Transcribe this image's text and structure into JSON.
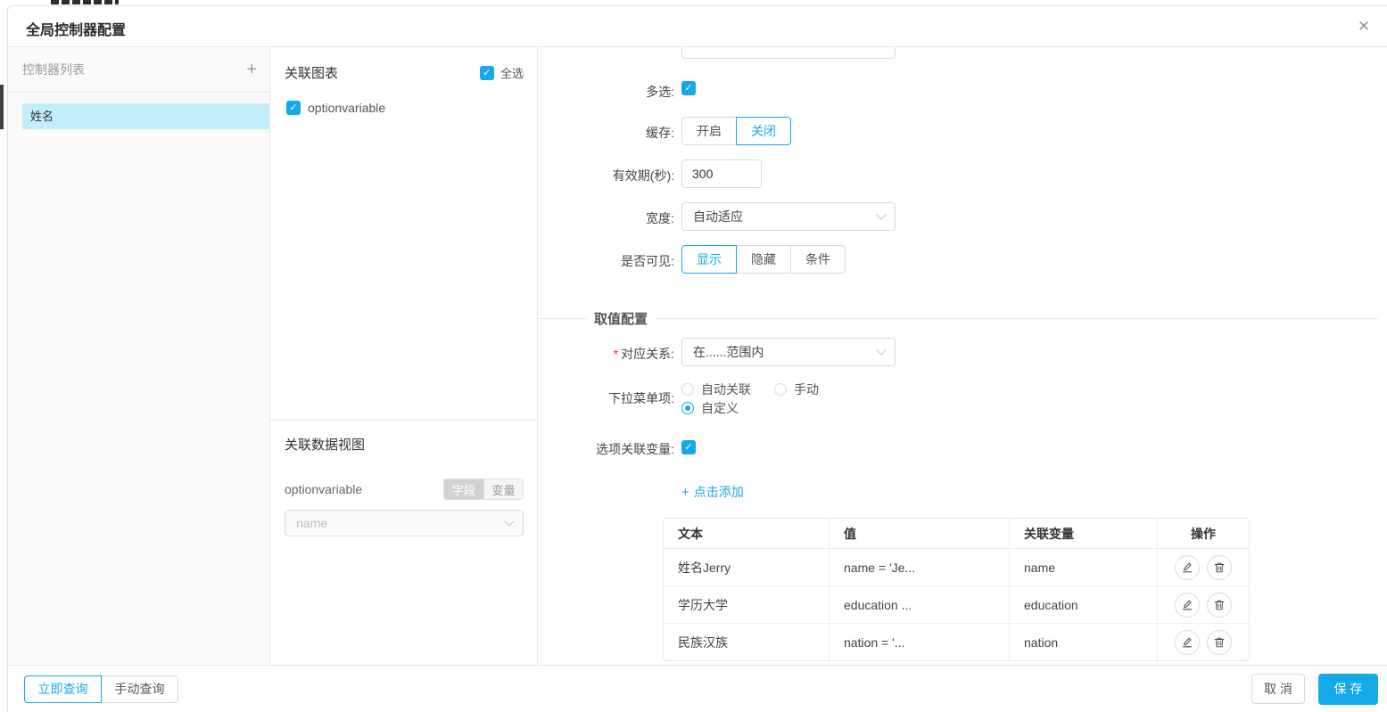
{
  "modal": {
    "title": "全局控制器配置",
    "close_icon": "✕"
  },
  "icons": {
    "plus": "+",
    "check": "✓"
  },
  "colors": {
    "accent": "#14a9e9",
    "selected_item_bg": "#c3edfb",
    "border": "#e8e8e8"
  },
  "left_panel": {
    "header": "控制器列表",
    "items": [
      {
        "label": "姓名",
        "selected": true
      }
    ]
  },
  "chart_panel": {
    "header": "关联图表",
    "select_all_label": "全选",
    "select_all_checked": true,
    "charts": [
      {
        "label": "optionvariable",
        "checked": true
      }
    ]
  },
  "dataview_panel": {
    "header": "关联数据视图",
    "view_name": "optionvariable",
    "toggle": {
      "field_label": "字段",
      "variable_label": "变量",
      "selected": "字段"
    },
    "field_select": {
      "value": "name",
      "disabled": true
    }
  },
  "form": {
    "multi_select": {
      "label": "多选:",
      "checked": true
    },
    "cache": {
      "label": "缓存:",
      "options": [
        "开启",
        "关闭"
      ],
      "selected": "关闭"
    },
    "validity": {
      "label": "有效期(秒):",
      "value": "300"
    },
    "width": {
      "label": "宽度:",
      "value": "自动适应"
    },
    "visibility": {
      "label": "是否可见:",
      "options": [
        "显示",
        "隐藏",
        "条件"
      ],
      "selected": "显示"
    },
    "section_title": "取值配置",
    "relation": {
      "label": "对应关系:",
      "required": true,
      "value": "在......范围内"
    },
    "dropdown_items": {
      "label": "下拉菜单项:",
      "options": [
        "自动关联",
        "手动",
        "自定义"
      ],
      "selected": "自定义"
    },
    "option_variable": {
      "label": "选项关联变量:",
      "checked": true
    },
    "add_link_label": "点击添加"
  },
  "options_table": {
    "headers": [
      "文本",
      "值",
      "关联变量",
      "操作"
    ],
    "rows": [
      {
        "text": "姓名Jerry",
        "value": "name = 'Je...",
        "variable": "name"
      },
      {
        "text": "学历大学",
        "value": "education ...",
        "variable": "education"
      },
      {
        "text": "民族汉族",
        "value": "nation = '...",
        "variable": "nation"
      }
    ]
  },
  "footer": {
    "query_now": "立即查询",
    "manual_query": "手动查询",
    "cancel": "取 消",
    "save": "保 存"
  }
}
